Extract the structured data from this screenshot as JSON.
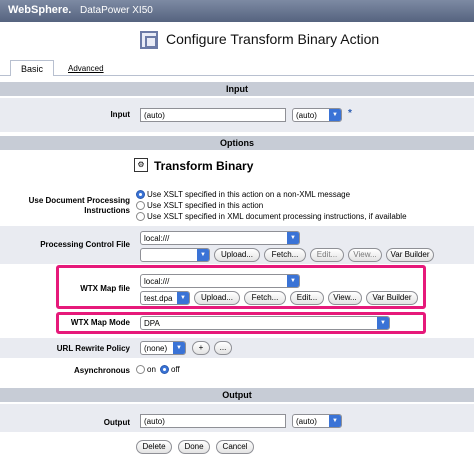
{
  "app": {
    "brand": "WebSphere.",
    "product": "DataPower XI50"
  },
  "page": {
    "title": "Configure Transform Binary Action"
  },
  "tabs": {
    "basic": "Basic",
    "advanced": "Advanced"
  },
  "sections": {
    "input": "Input",
    "options": "Options",
    "output": "Output"
  },
  "input": {
    "label": "Input",
    "field_value": "(auto)",
    "select_value": "(auto)",
    "required_marker": "*"
  },
  "options": {
    "heading": "Transform Binary",
    "doc_processing": {
      "label_line1": "Use Document Processing",
      "label_line2": "Instructions",
      "choices": [
        "Use XSLT specified in this action on a non-XML message",
        "Use XSLT specified in this action",
        "Use XSLT specified in XML document processing instructions, if available"
      ],
      "selected_index": 0
    },
    "processing_control_file": {
      "label": "Processing Control File",
      "location": "local:///",
      "file": "",
      "buttons": [
        "Upload...",
        "Fetch...",
        "Edit...",
        "View...",
        "Var Builder"
      ]
    },
    "wtx_map_file": {
      "label": "WTX Map file",
      "location": "local:///",
      "file": "test.dpa",
      "buttons": [
        "Upload...",
        "Fetch...",
        "Edit...",
        "View...",
        "Var Builder"
      ]
    },
    "wtx_map_mode": {
      "label": "WTX Map Mode",
      "value": "DPA"
    },
    "url_rewrite_policy": {
      "label": "URL Rewrite Policy",
      "value": "(none)",
      "add": "+",
      "more": "..."
    },
    "asynchronous": {
      "label": "Asynchronous",
      "on": "on",
      "off": "off",
      "selected": "off"
    }
  },
  "output": {
    "label": "Output",
    "field_value": "(auto)",
    "select_value": "(auto)"
  },
  "actions": {
    "delete": "Delete",
    "done": "Done",
    "cancel": "Cancel"
  },
  "colors": {
    "highlight": "#e6197a",
    "section": "#c7ccd6",
    "band": "#e9ebf1",
    "select_arrow": "#3a73d6"
  }
}
